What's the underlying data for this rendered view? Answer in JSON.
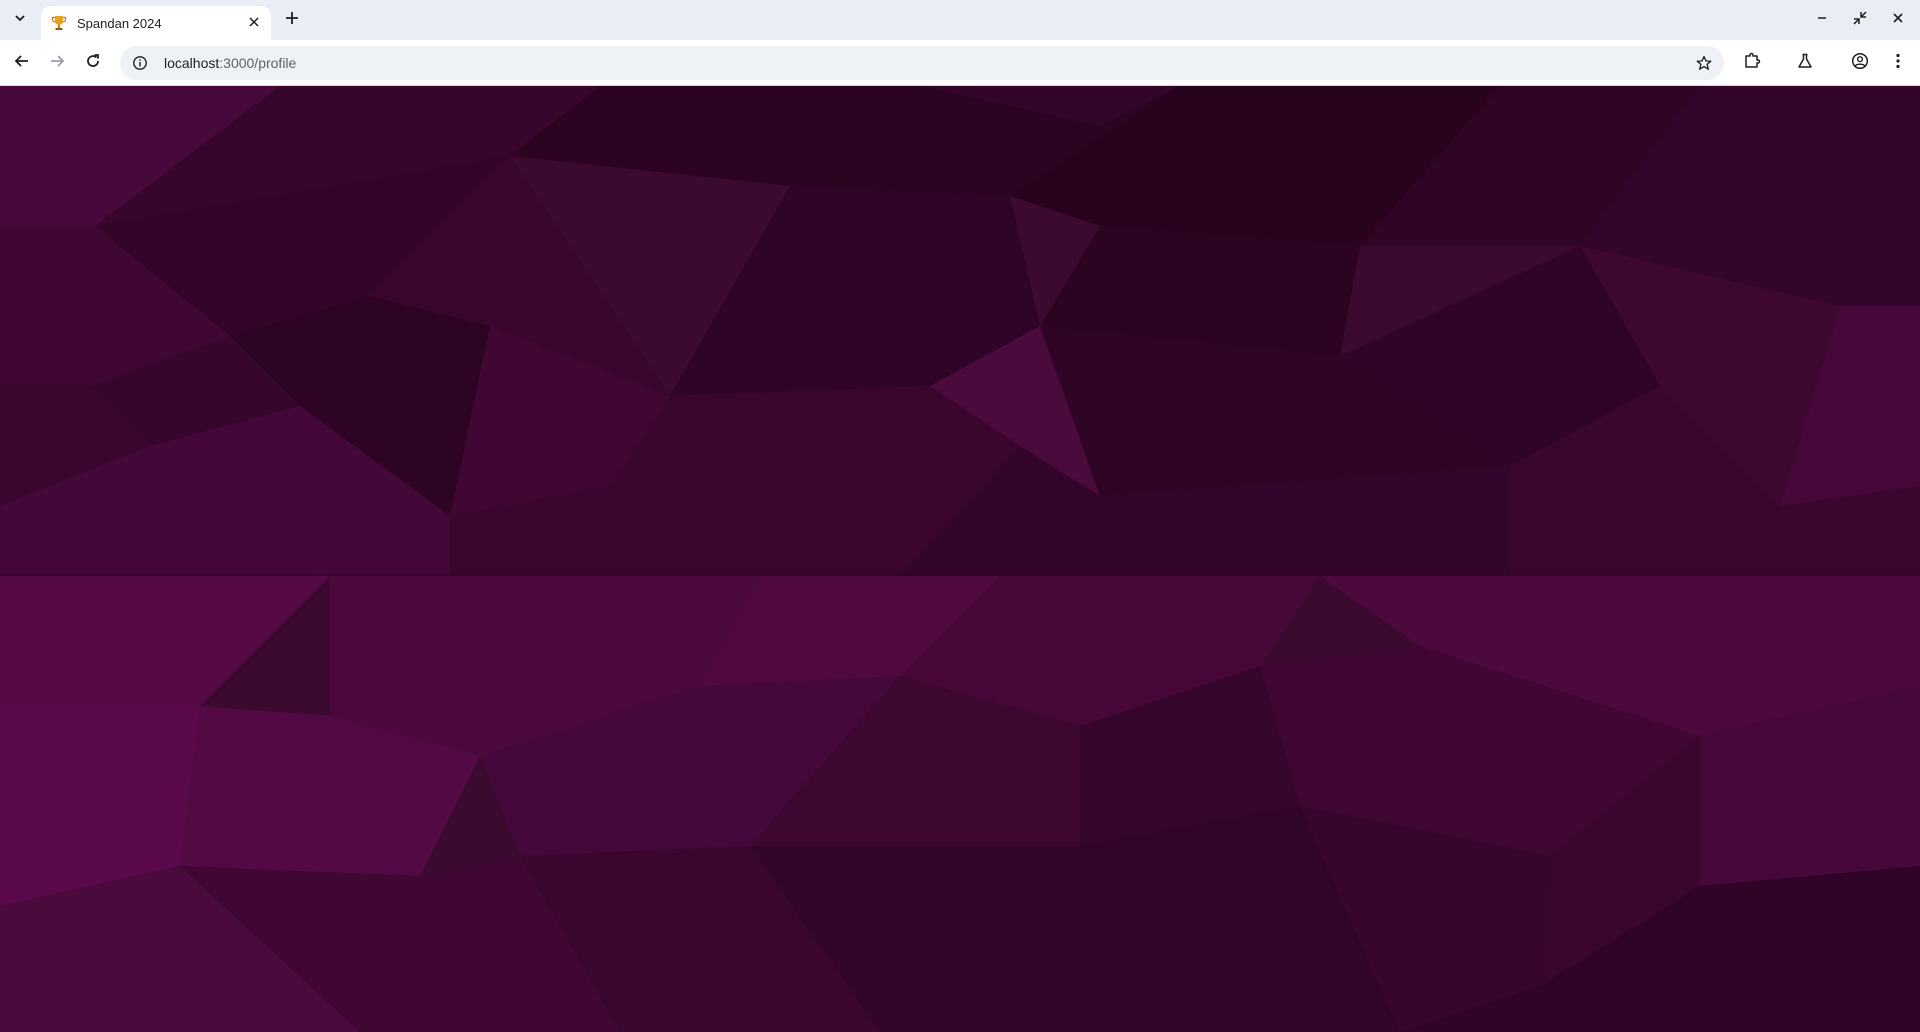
{
  "browser": {
    "tab": {
      "title": "Spandan 2024",
      "favicon": "trophy-icon"
    },
    "address_bar": {
      "host": "localhost",
      "path": ":3000/profile"
    },
    "icons": {
      "tab_search": "chevron-down-icon",
      "tab_close": "close-icon",
      "new_tab": "plus-icon",
      "minimize": "minimize-icon",
      "restore": "restore-icon",
      "window_close": "close-icon",
      "back": "arrow-left-icon",
      "forward": "arrow-right-icon",
      "reload": "reload-icon",
      "site_info": "info-icon",
      "bookmark": "star-icon",
      "extensions": "puzzle-icon",
      "labs": "flask-icon",
      "profile": "profile-icon",
      "menu": "kebab-menu-icon"
    }
  },
  "page": {
    "background_color": "#3d0a2f",
    "accent_colors": [
      "#2a0420",
      "#4a0a3a",
      "#5a0a4a",
      "#380628"
    ]
  }
}
